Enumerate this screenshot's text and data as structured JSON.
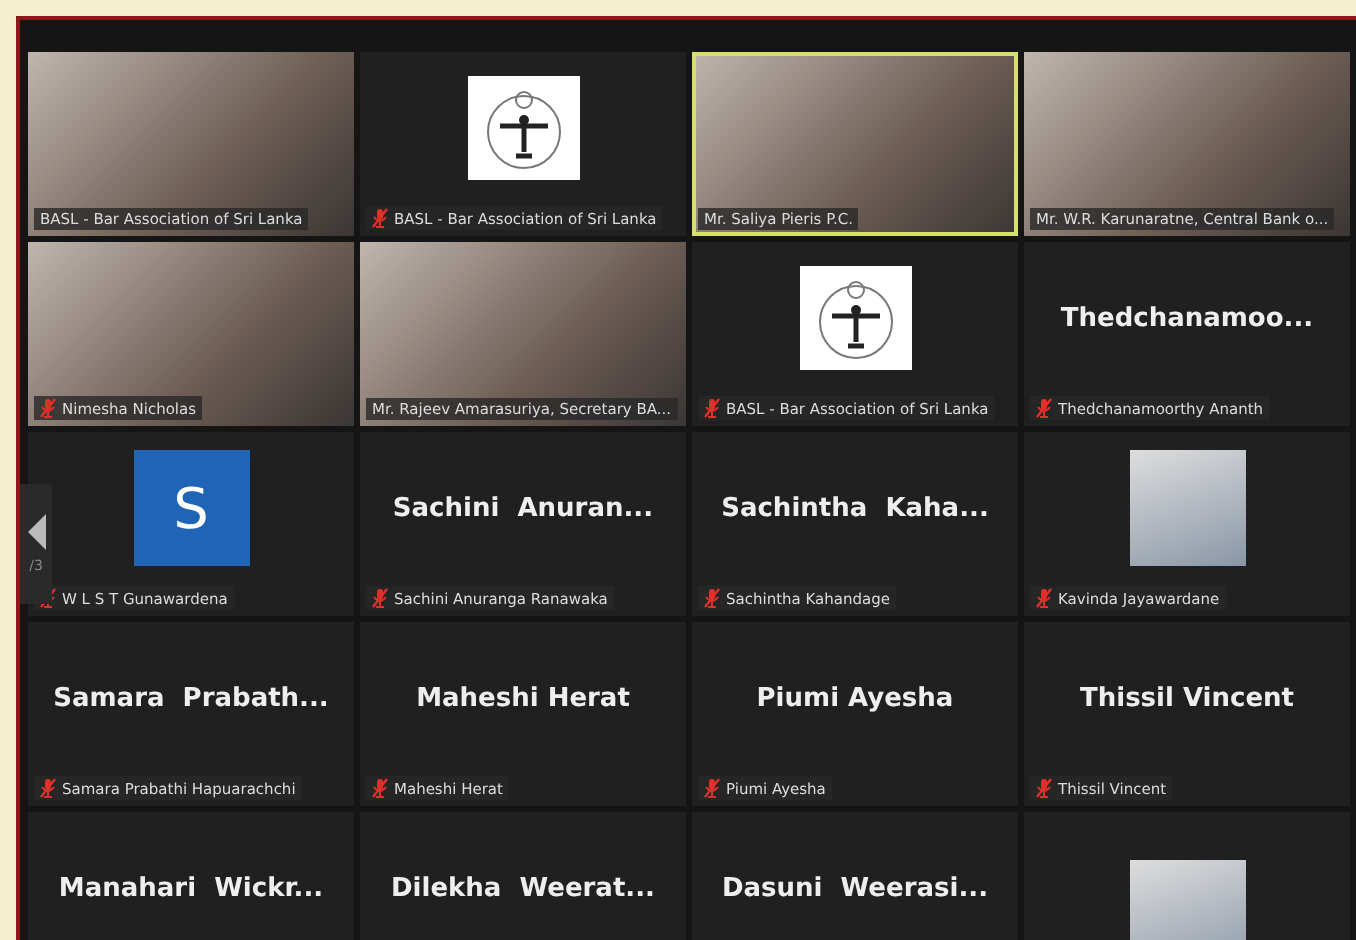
{
  "pager": {
    "text": "/3"
  },
  "tiles": [
    {
      "kind": "video",
      "label": "BASL - Bar Association of Sri Lanka",
      "muted": false,
      "selected": false
    },
    {
      "kind": "logo",
      "label": "BASL - Bar Association of Sri Lanka",
      "muted": true,
      "selected": false
    },
    {
      "kind": "video",
      "label": "Mr. Saliya Pieris P.C.",
      "muted": false,
      "selected": true
    },
    {
      "kind": "video",
      "label": "Mr. W.R. Karunaratne, Central Bank o...",
      "muted": false,
      "selected": false
    },
    {
      "kind": "video",
      "label": "Nimesha Nicholas",
      "muted": true,
      "selected": false
    },
    {
      "kind": "video",
      "label": "Mr. Rajeev Amarasuriya, Secretary BA...",
      "muted": false,
      "selected": false
    },
    {
      "kind": "logo",
      "label": "BASL - Bar Association of Sri Lanka",
      "muted": true,
      "selected": false
    },
    {
      "kind": "name",
      "display_name": "Thedchanamoo...",
      "label": "Thedchanamoorthy Ananth",
      "muted": true,
      "selected": false
    },
    {
      "kind": "letter",
      "letter": "S",
      "label": "W L S T Gunawardena",
      "muted": true,
      "selected": false
    },
    {
      "kind": "name",
      "display_name": "Sachini  Anuran...",
      "label": "Sachini Anuranga Ranawaka",
      "muted": true,
      "selected": false
    },
    {
      "kind": "name",
      "display_name": "Sachintha  Kaha...",
      "label": "Sachintha Kahandage",
      "muted": true,
      "selected": false
    },
    {
      "kind": "photo",
      "label": "Kavinda Jayawardane",
      "muted": true,
      "selected": false
    },
    {
      "kind": "name",
      "display_name": "Samara  Prabath...",
      "label": "Samara Prabathi Hapuarachchi",
      "muted": true,
      "selected": false
    },
    {
      "kind": "name",
      "display_name": "Maheshi Herat",
      "label": "Maheshi Herat",
      "muted": true,
      "selected": false
    },
    {
      "kind": "name",
      "display_name": "Piumi Ayesha",
      "label": "Piumi Ayesha",
      "muted": true,
      "selected": false
    },
    {
      "kind": "name",
      "display_name": "Thissil Vincent",
      "label": "Thissil Vincent",
      "muted": true,
      "selected": false
    },
    {
      "kind": "name",
      "display_name": "Manahari  Wickr...",
      "selected": false
    },
    {
      "kind": "name",
      "display_name": "Dilekha  Weerat...",
      "selected": false
    },
    {
      "kind": "name",
      "display_name": "Dasuni  Weerasi...",
      "selected": false
    },
    {
      "kind": "photo",
      "selected": false
    }
  ]
}
